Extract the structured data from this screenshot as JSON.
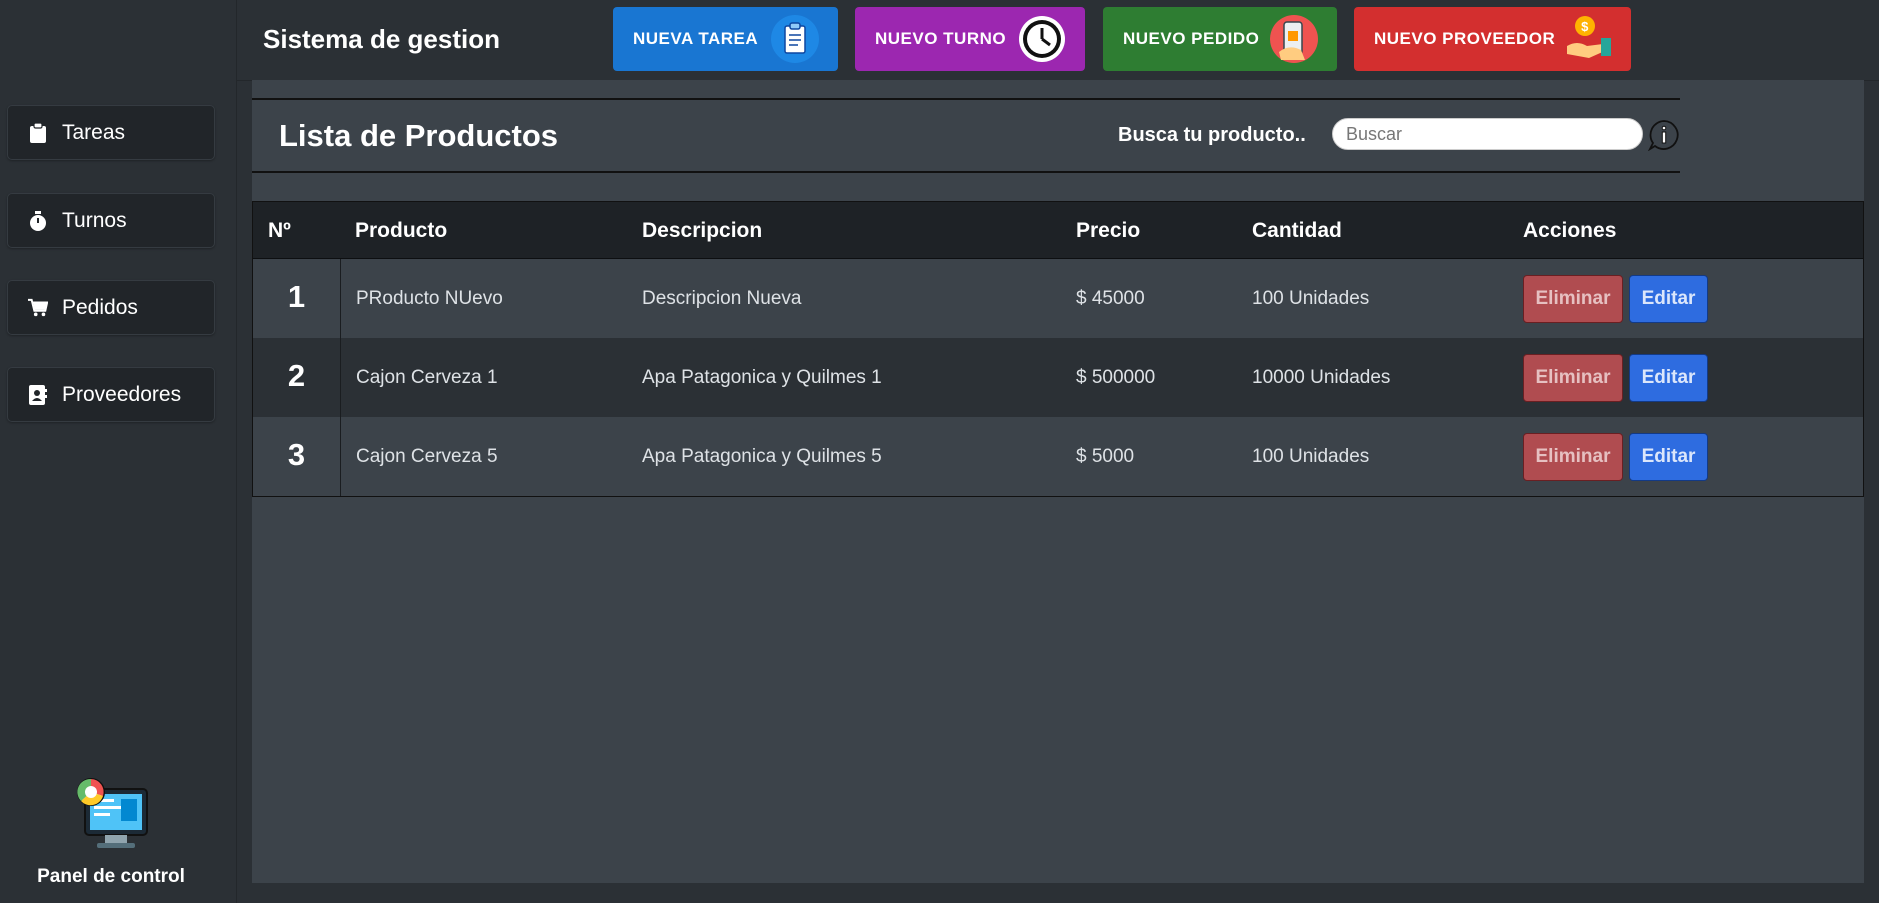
{
  "app": {
    "title": "Sistema de gestion"
  },
  "quick_actions": [
    {
      "label": "NUEVA TAREA",
      "color": "#1976d2",
      "icon": "clipboard-icon"
    },
    {
      "label": "NUEVO TURNO",
      "color": "#9c27b0",
      "icon": "clock-icon"
    },
    {
      "label": "NUEVO PEDIDO",
      "color": "#2e7d32",
      "icon": "phone-order-icon"
    },
    {
      "label": "NUEVO PROVEEDOR",
      "color": "#d32f2f",
      "icon": "hand-money-icon"
    }
  ],
  "sidebar": {
    "items": [
      {
        "label": "Tareas",
        "icon": "clipboard-icon"
      },
      {
        "label": "Turnos",
        "icon": "stopwatch-icon"
      },
      {
        "label": "Pedidos",
        "icon": "cart-icon"
      },
      {
        "label": "Proveedores",
        "icon": "contact-book-icon"
      }
    ],
    "panel": {
      "label": "Panel de control",
      "icon": "dashboard-monitor-icon"
    }
  },
  "main": {
    "title": "Lista de Productos",
    "search": {
      "label": "Busca tu producto..",
      "placeholder": "Buscar",
      "value": ""
    }
  },
  "table": {
    "headers": [
      "Nº",
      "Producto",
      "Descripcion",
      "Precio",
      "Cantidad",
      "Acciones"
    ],
    "rows": [
      {
        "num": "1",
        "producto": "PRoducto NUevo",
        "descripcion": "Descripcion Nueva",
        "precio": "$ 45000",
        "cantidad": "100 Unidades"
      },
      {
        "num": "2",
        "producto": "Cajon Cerveza 1",
        "descripcion": "Apa Patagonica y Quilmes 1",
        "precio": "$ 500000",
        "cantidad": "10000 Unidades"
      },
      {
        "num": "3",
        "producto": "Cajon Cerveza 5",
        "descripcion": "Apa Patagonica y Quilmes 5",
        "precio": "$ 5000",
        "cantidad": "100 Unidades"
      }
    ],
    "delete_label": "Eliminar",
    "edit_label": "Editar"
  }
}
